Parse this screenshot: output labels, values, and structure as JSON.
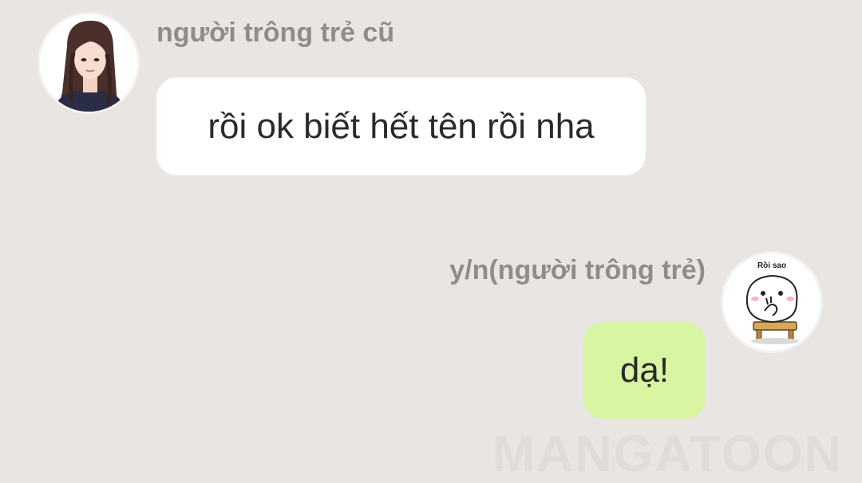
{
  "messages": [
    {
      "sender": "người trông trẻ cũ",
      "text": "rồi ok biết hết tên rồi nha",
      "side": "left",
      "bubble_color": "#ffffff",
      "avatar": "long-haired-woman-avatar"
    },
    {
      "sender": "y/n(người trông trẻ)",
      "text": "dạ!",
      "side": "right",
      "bubble_color": "#d8f5a2",
      "avatar": "blob-sticker-avatar",
      "avatar_caption": "Rồi sao"
    }
  ],
  "watermark": "MANGATOON",
  "colors": {
    "background": "#e8e5e2",
    "sender_text": "#8f8c8a",
    "message_text": "#2a2a2a"
  }
}
